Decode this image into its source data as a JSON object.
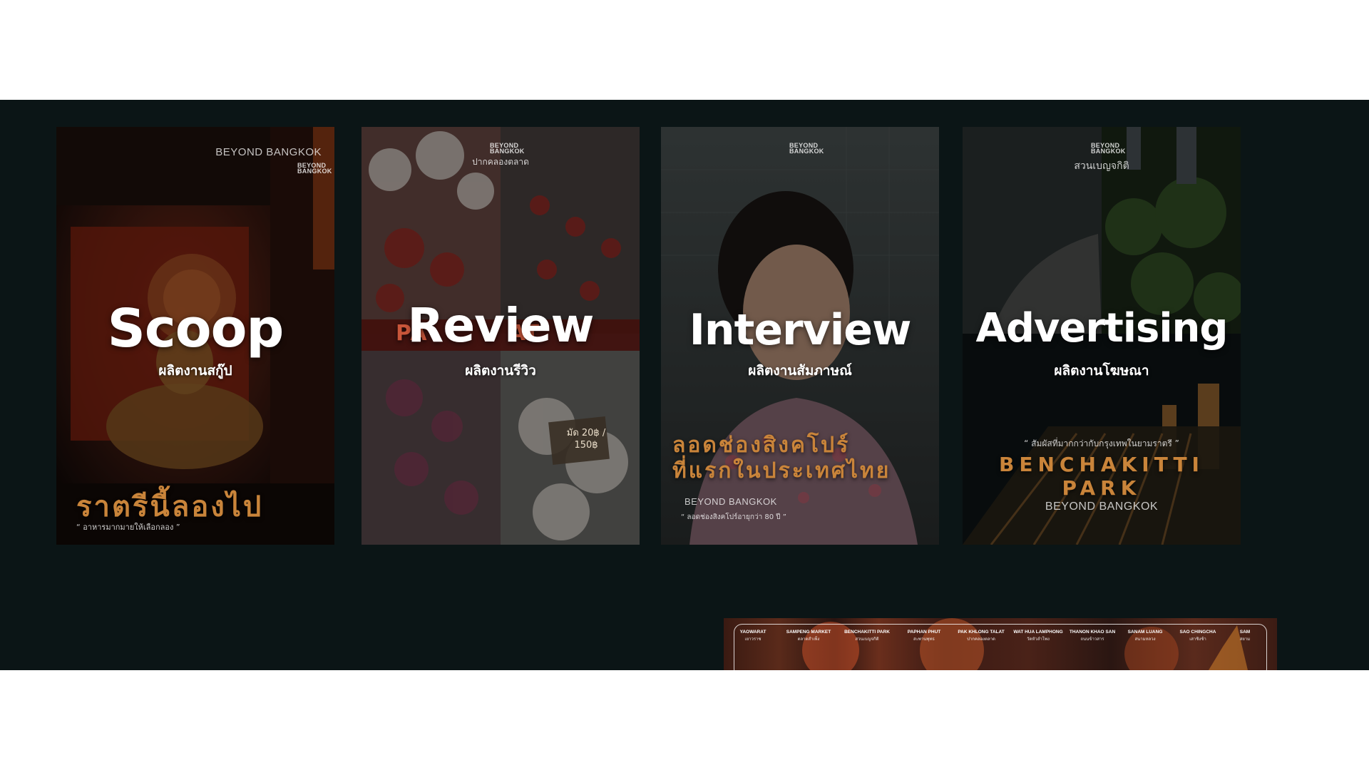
{
  "cards": [
    {
      "title": "Scoop",
      "subtitle": "ผลิตงานสกู๊ป",
      "brand": "BEYOND BANGKOK",
      "logo": "BEYOND BANGKOK",
      "headline": "ราตรีนี้ลองไป",
      "caption": "“ อาหารมากมายให้เลือกลอง ”"
    },
    {
      "title": "Review",
      "subtitle": "ผลิตงานรีวิว",
      "logo": "BEYOND BANGKOK",
      "location": "ปากคลองตลาด",
      "sign_text": "PA          AT",
      "price_text": "มัด 20฿ / 150฿"
    },
    {
      "title": "Interview",
      "subtitle": "ผลิตงานสัมภาษณ์",
      "logo": "BEYOND BANGKOK",
      "headline_line1": "ลอดช่องสิงคโปร์",
      "headline_line2": "ที่แรกในประเทศไทย",
      "brand": "BEYOND BANGKOK",
      "caption": "“ ลอดช่องสิงคโปร์อายุกว่า 80 ปี ”"
    },
    {
      "title": "Advertising",
      "subtitle": "ผลิตงานโฆษณา",
      "logo": "BEYOND BANGKOK",
      "location": "สวนเบญจกิติ",
      "quote": "“ สัมผัสที่มากกว่ากับกรุงเทพในยามราตรี ”",
      "headline": "BENCHAKITTI PARK",
      "brand": "BEYOND BANGKOK"
    }
  ],
  "map_strip": {
    "items": [
      {
        "en": "YAOWARAT",
        "th": "เยาวราช"
      },
      {
        "en": "SAMPENG MARKET",
        "th": "ตลาดสำเพ็ง"
      },
      {
        "en": "BENCHAKITTI PARK",
        "th": "สวนเบญจกิติ"
      },
      {
        "en": "PAPHAN PHUT",
        "th": "สะพานพุทธ"
      },
      {
        "en": "PAK KHLONG TALAT",
        "th": "ปากคลองตลาด"
      },
      {
        "en": "WAT HUA LAMPHONG",
        "th": "วัดหัวลำโพง"
      },
      {
        "en": "THANON KHAO SAN",
        "th": "ถนนข้าวสาร"
      },
      {
        "en": "SANAM LUANG",
        "th": "สนามหลวง"
      },
      {
        "en": "SAO CHINGCHA",
        "th": "เสาชิงช้า"
      },
      {
        "en": "SAM",
        "th": "สยาม"
      }
    ]
  },
  "colors": {
    "band": "#0b1516",
    "accent_orange": "#c9843a"
  }
}
